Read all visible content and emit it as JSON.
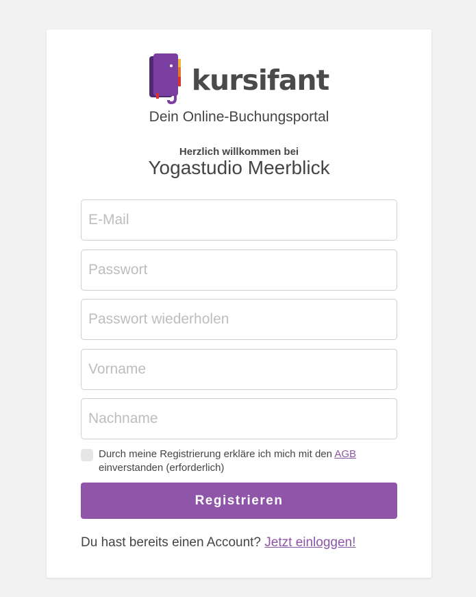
{
  "brand": {
    "name": "kursifant",
    "tagline": "Dein Online-Buchungsportal",
    "colors": {
      "primary": "#8f55a8",
      "logo_purple": "#7b3fa0",
      "logo_dark_purple": "#4e2a73",
      "logo_orange": "#e8742a",
      "logo_red": "#d9342b",
      "logo_yellow": "#f2b632",
      "text": "#444444"
    }
  },
  "welcome": {
    "line1": "Herzlich willkommen bei",
    "studio": "Yogastudio Meerblick"
  },
  "form": {
    "email_placeholder": "E-Mail",
    "password_placeholder": "Passwort",
    "password_repeat_placeholder": "Passwort wiederholen",
    "firstname_placeholder": "Vorname",
    "lastname_placeholder": "Nachname",
    "consent_before": "Durch meine Registrierung erkläre ich mich mit den ",
    "consent_link": "AGB",
    "consent_after": " einverstanden (erforderlich)",
    "consent_checked": false,
    "submit_label": "Registrieren"
  },
  "login": {
    "prompt": "Du hast bereits einen Account? ",
    "link": "Jetzt einloggen!"
  }
}
